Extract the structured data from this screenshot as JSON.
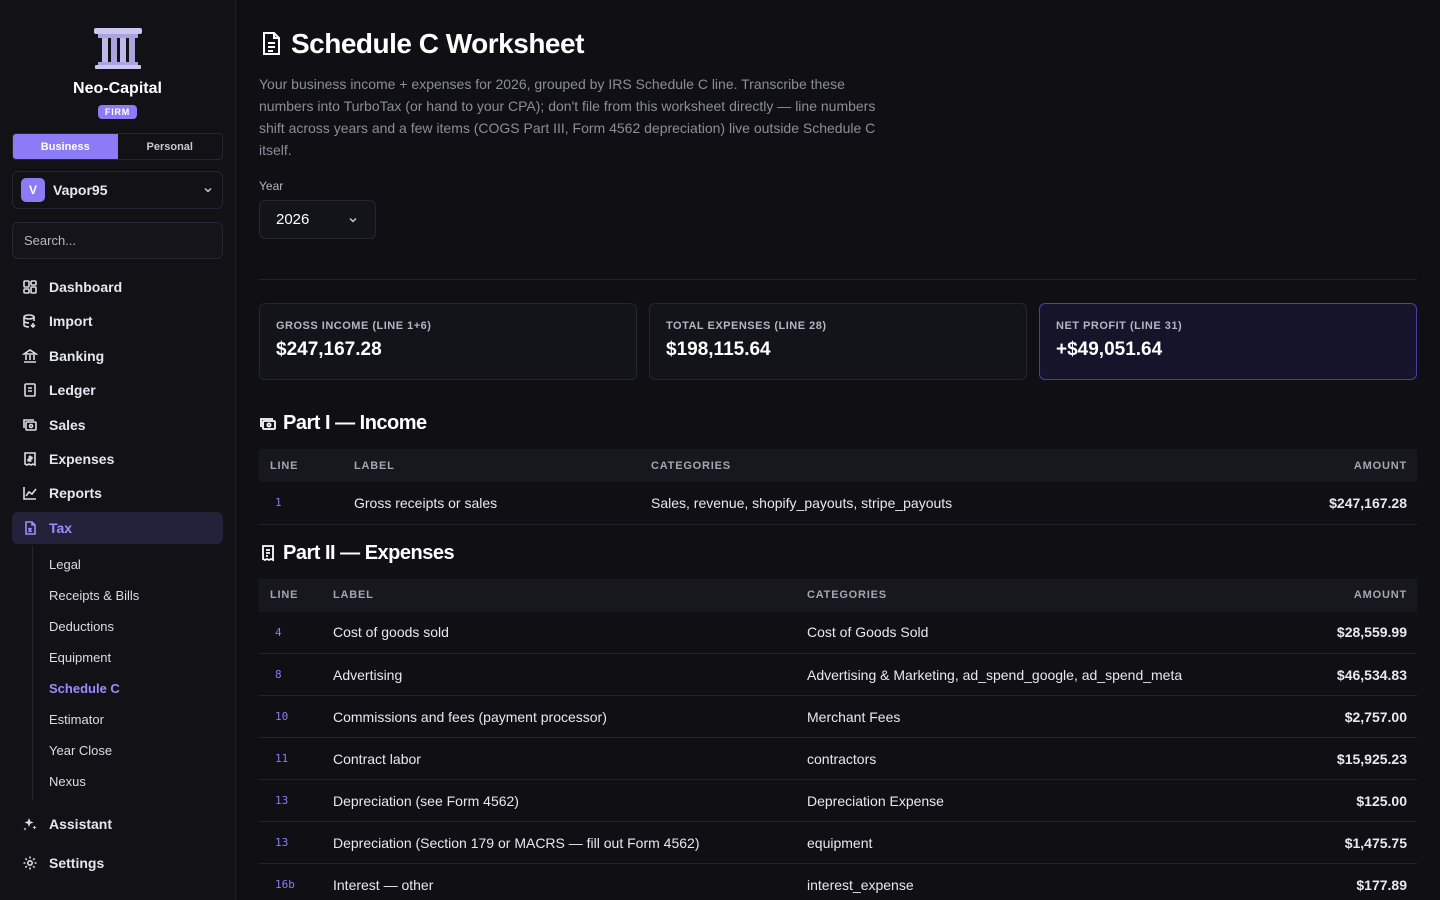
{
  "sidebar": {
    "brand": "Neo-Capital",
    "badge": "FIRM",
    "mode_tabs": [
      "Business",
      "Personal"
    ],
    "workspace": {
      "initial": "V",
      "name": "Vapor95"
    },
    "search_placeholder": "Search...",
    "nav": [
      {
        "label": "Dashboard",
        "icon": "dashboard-icon"
      },
      {
        "label": "Import",
        "icon": "import-icon"
      },
      {
        "label": "Banking",
        "icon": "bank-icon"
      },
      {
        "label": "Ledger",
        "icon": "ledger-icon"
      },
      {
        "label": "Sales",
        "icon": "sales-icon"
      },
      {
        "label": "Expenses",
        "icon": "receipt-icon"
      },
      {
        "label": "Reports",
        "icon": "chart-icon"
      },
      {
        "label": "Tax",
        "icon": "tax-icon",
        "active": true
      }
    ],
    "tax_sub": [
      "Legal",
      "Receipts & Bills",
      "Deductions",
      "Equipment",
      "Schedule C",
      "Estimator",
      "Year Close",
      "Nexus"
    ],
    "active_sub": "Schedule C",
    "bottom_nav": [
      {
        "label": "Assistant",
        "icon": "sparkle-icon"
      },
      {
        "label": "Settings",
        "icon": "gear-icon"
      }
    ]
  },
  "page": {
    "title": "Schedule C Worksheet",
    "description": "Your business income + expenses for 2026, grouped by IRS Schedule C line. Transcribe these numbers into TurboTax (or hand to your CPA); don't file from this worksheet directly — line numbers shift across years and a few items (COGS Part III, Form 4562 depreciation) live outside Schedule C itself.",
    "year_label": "Year",
    "year": "2026"
  },
  "summary": [
    {
      "label": "GROSS INCOME (LINE 1+6)",
      "value": "$247,167.28"
    },
    {
      "label": "TOTAL EXPENSES (LINE 28)",
      "value": "$198,115.64"
    },
    {
      "label": "NET PROFIT (LINE 31)",
      "value": "+$49,051.64",
      "highlight": true
    }
  ],
  "income": {
    "title": "Part I — Income",
    "columns": [
      "LINE",
      "LABEL",
      "CATEGORIES",
      "AMOUNT"
    ],
    "rows": [
      {
        "line": "1",
        "label": "Gross receipts or sales",
        "categories": "Sales, revenue, shopify_payouts, stripe_payouts",
        "amount": "$247,167.28"
      }
    ]
  },
  "expenses": {
    "title": "Part II — Expenses",
    "columns": [
      "LINE",
      "LABEL",
      "CATEGORIES",
      "AMOUNT"
    ],
    "rows": [
      {
        "line": "4",
        "label": "Cost of goods sold",
        "categories": "Cost of Goods Sold",
        "amount": "$28,559.99"
      },
      {
        "line": "8",
        "label": "Advertising",
        "categories": "Advertising & Marketing, ad_spend_google, ad_spend_meta",
        "amount": "$46,534.83"
      },
      {
        "line": "10",
        "label": "Commissions and fees (payment processor)",
        "categories": "Merchant Fees",
        "amount": "$2,757.00"
      },
      {
        "line": "11",
        "label": "Contract labor",
        "categories": "contractors",
        "amount": "$15,925.23"
      },
      {
        "line": "13",
        "label": "Depreciation (see Form 4562)",
        "categories": "Depreciation Expense",
        "amount": "$125.00"
      },
      {
        "line": "13",
        "label": "Depreciation (Section 179 or MACRS — fill out Form 4562)",
        "categories": "equipment",
        "amount": "$1,475.75"
      },
      {
        "line": "16b",
        "label": "Interest — other",
        "categories": "interest_expense",
        "amount": "$177.89"
      }
    ]
  },
  "colors": {
    "accent": "#8b7cf6",
    "background": "#0f0f14",
    "sidebar": "#111116"
  }
}
